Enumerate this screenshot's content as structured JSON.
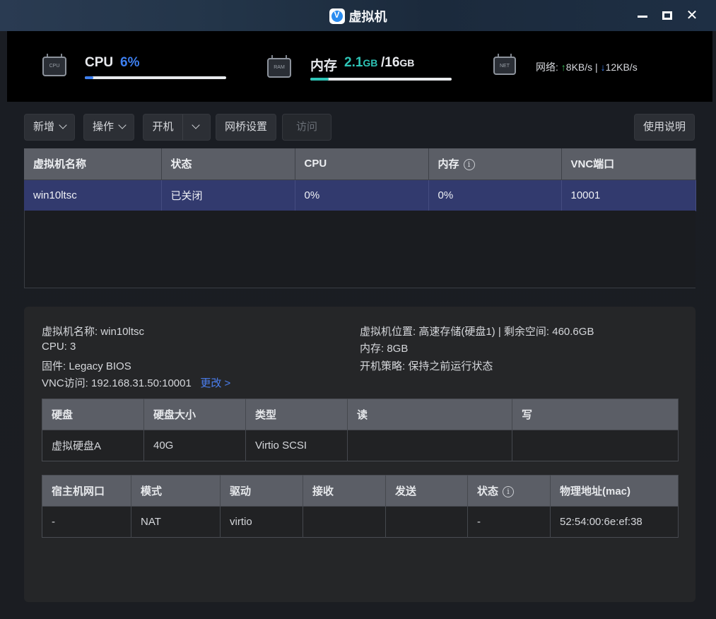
{
  "window": {
    "title": "虚拟机",
    "app_icon_glyph": "V",
    "minimize_icon": "minimize-icon",
    "maximize_icon": "maximize-icon",
    "close_glyph": "✕"
  },
  "stats": {
    "cpu": {
      "icon_text": "CPU",
      "label": "CPU",
      "value": "6%",
      "usage": 0.06,
      "color": "#3d7ff0"
    },
    "memory": {
      "icon_text": "RAM",
      "label": "内存",
      "used": "2.1",
      "used_unit": "GB",
      "sep": "/",
      "total": "16",
      "total_unit": "GB",
      "usage": 0.13,
      "color": "#2ec4b6"
    },
    "network": {
      "icon_text": "NET",
      "label": "网络:",
      "up_arrow": "↑",
      "up": "8KB/s",
      "sep": "|",
      "down_arrow": "↓",
      "down": "12KB/s",
      "up_color": "#3ac45a",
      "down_color": "#3d7ff0"
    }
  },
  "toolbar": {
    "add": "新增",
    "operate": "操作",
    "power_on": "开机",
    "bridge": "网桥设置",
    "visit": "访问",
    "help": "使用说明"
  },
  "vm_table": {
    "headers": [
      "虚拟机名称",
      "状态",
      "CPU",
      "内存",
      "VNC端口"
    ],
    "rows": [
      [
        "win10ltsc",
        "已关闭",
        "0%",
        "0%",
        "10001"
      ]
    ]
  },
  "details": {
    "name": "虚拟机名称: win10ltsc",
    "cpu": "CPU: 3",
    "firmware": "固件: Legacy BIOS",
    "vnc": "VNC访问: 192.168.31.50:10001",
    "vnc_change": "更改 >",
    "location": "虚拟机位置: 高速存储(硬盘1) | 剩余空间: 460.6GB",
    "memory": "内存: 8GB",
    "boot_policy": "开机策略: 保持之前运行状态"
  },
  "disk_table": {
    "headers": [
      "硬盘",
      "硬盘大小",
      "类型",
      "读",
      "写"
    ],
    "rows": [
      [
        "虚拟硬盘A",
        "40G",
        "Virtio SCSI",
        "",
        ""
      ]
    ]
  },
  "nic_table": {
    "headers": [
      "宿主机网口",
      "模式",
      "驱动",
      "接收",
      "发送",
      "状态",
      "物理地址(mac)"
    ],
    "rows": [
      [
        "-",
        "NAT",
        "virtio",
        "",
        "",
        "-",
        "52:54:00:6e:ef:38"
      ]
    ]
  },
  "info_glyph": "i"
}
